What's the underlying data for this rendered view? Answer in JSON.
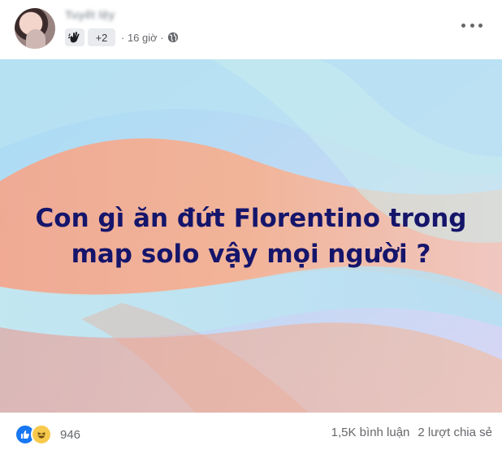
{
  "post": {
    "author": "Tuyết lệy",
    "group_extra_count": "+2",
    "time": "· 16 giờ ·",
    "caption_line1": "Con gì ăn đứt Florentino trong",
    "caption_line2": "map solo vậy mọi người ?",
    "icons": {
      "group": "wave-hand-icon",
      "privacy": "globe-icon",
      "menu": "more-options-icon",
      "reaction1": "like-icon",
      "reaction2": "haha-icon"
    }
  },
  "footer": {
    "reaction_count": "946",
    "comments": "1,5K bình luận",
    "shares": "2 lượt chia sẻ"
  },
  "colors": {
    "caption": "#15156b",
    "like": "#1877f2",
    "haha": "#f7c94c",
    "meta_text": "#65676b"
  }
}
